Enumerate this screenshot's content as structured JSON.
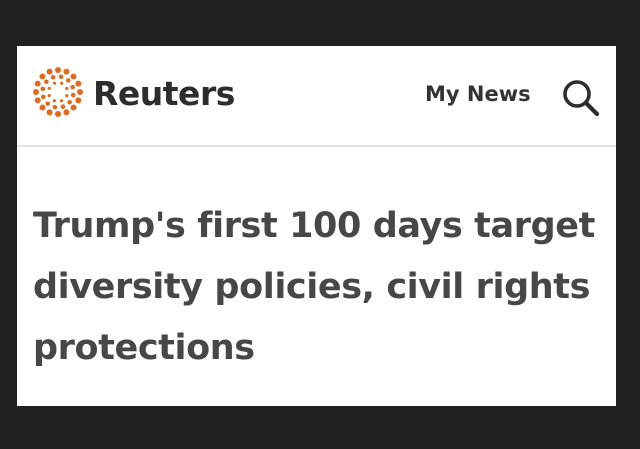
{
  "header": {
    "brand_name": "Reuters",
    "my_news_label": "My News",
    "search_icon": "search-icon"
  },
  "article": {
    "headline": "Trump's first 100 days target diversity policies, civil rights protections"
  },
  "colors": {
    "logo_orange": "#e2691d",
    "headline_text": "#474747",
    "page_bg": "#212121"
  }
}
